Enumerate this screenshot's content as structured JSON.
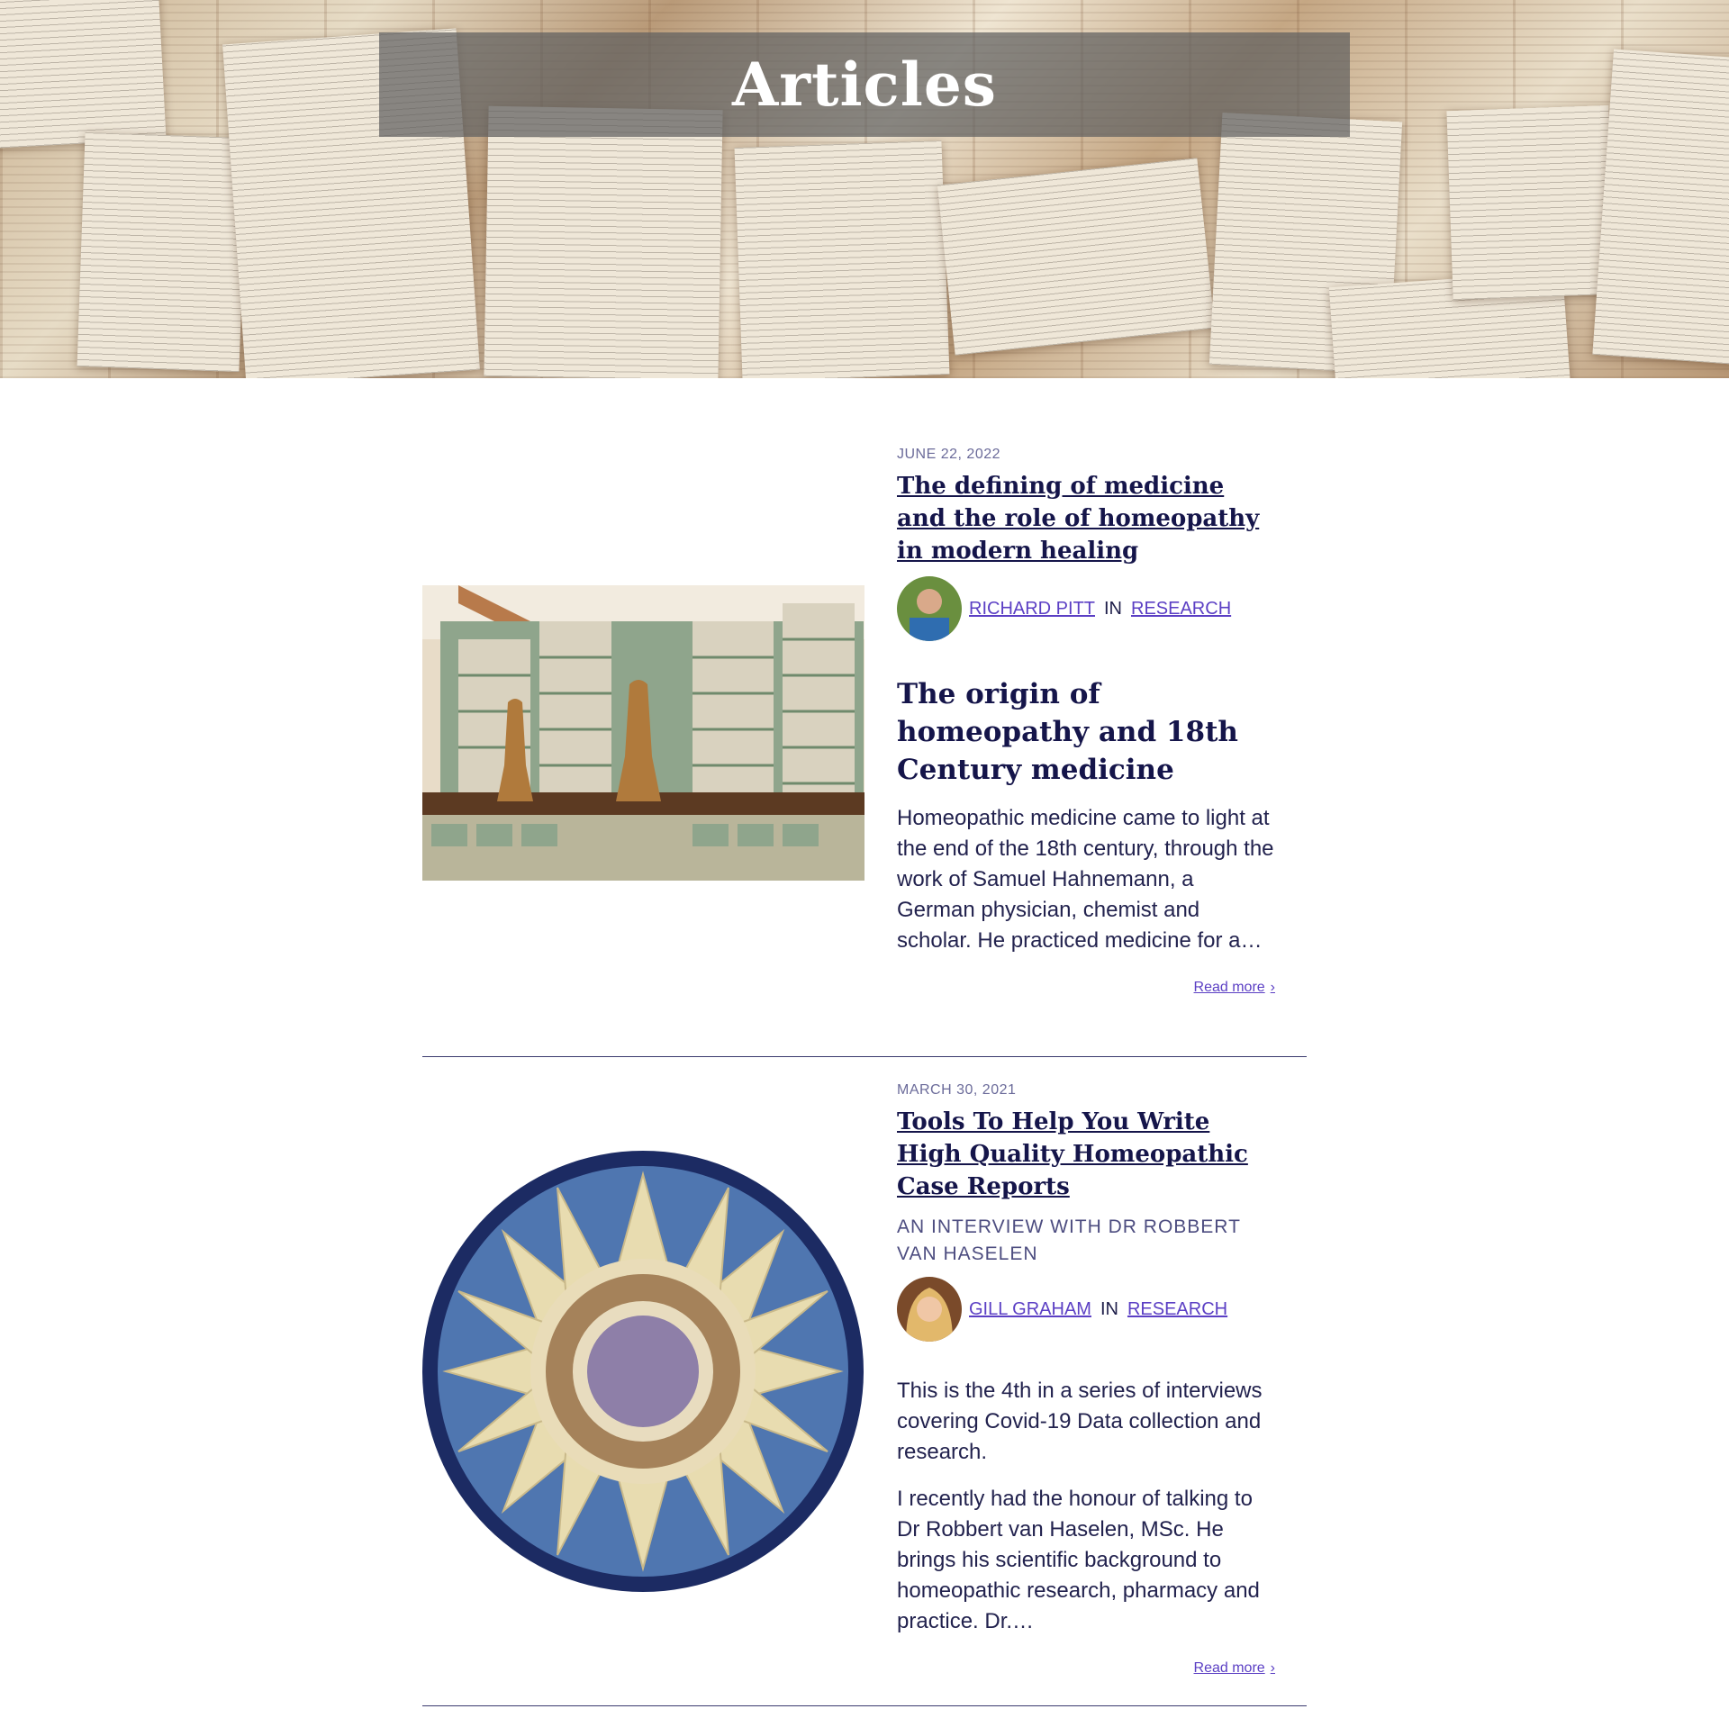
{
  "hero": {
    "title": "Articles"
  },
  "articles": [
    {
      "date": "JUNE 22, 2022",
      "title": "The defining of medicine and the role of homeopathy in modern healing",
      "author": "RICHARD PITT",
      "in_label": "IN",
      "category": "RESEARCH",
      "heading": "The origin of homeopathy and 18th Century medicine",
      "excerpt": "Homeopathic medicine came to light at the end of the 18th century, through the work of Samuel Hahnemann, a German physician, chemist and scholar. He practiced medicine for a…",
      "read_more": "Read more"
    },
    {
      "date": "MARCH 30, 2021",
      "title": "Tools To Help You Write High Quality Homeopathic Case Reports",
      "subtitle": "AN INTERVIEW WITH DR ROBBERT VAN HASELEN",
      "author": "GILL GRAHAM",
      "in_label": "IN",
      "category": "RESEARCH",
      "excerpt_1": "This is the 4th in a series of interviews covering Covid-19 Data collection and research.",
      "excerpt_2": "I recently had the honour of talking to Dr Robbert van Haselen, MSc. He brings his scientific background to homeopathic research, pharmacy and practice. Dr.…",
      "read_more": "Read more"
    }
  ],
  "colors": {
    "heading": "#15154a",
    "link": "#5b3fc4",
    "date": "#6b6b9a",
    "rule": "#3a3a6e"
  }
}
